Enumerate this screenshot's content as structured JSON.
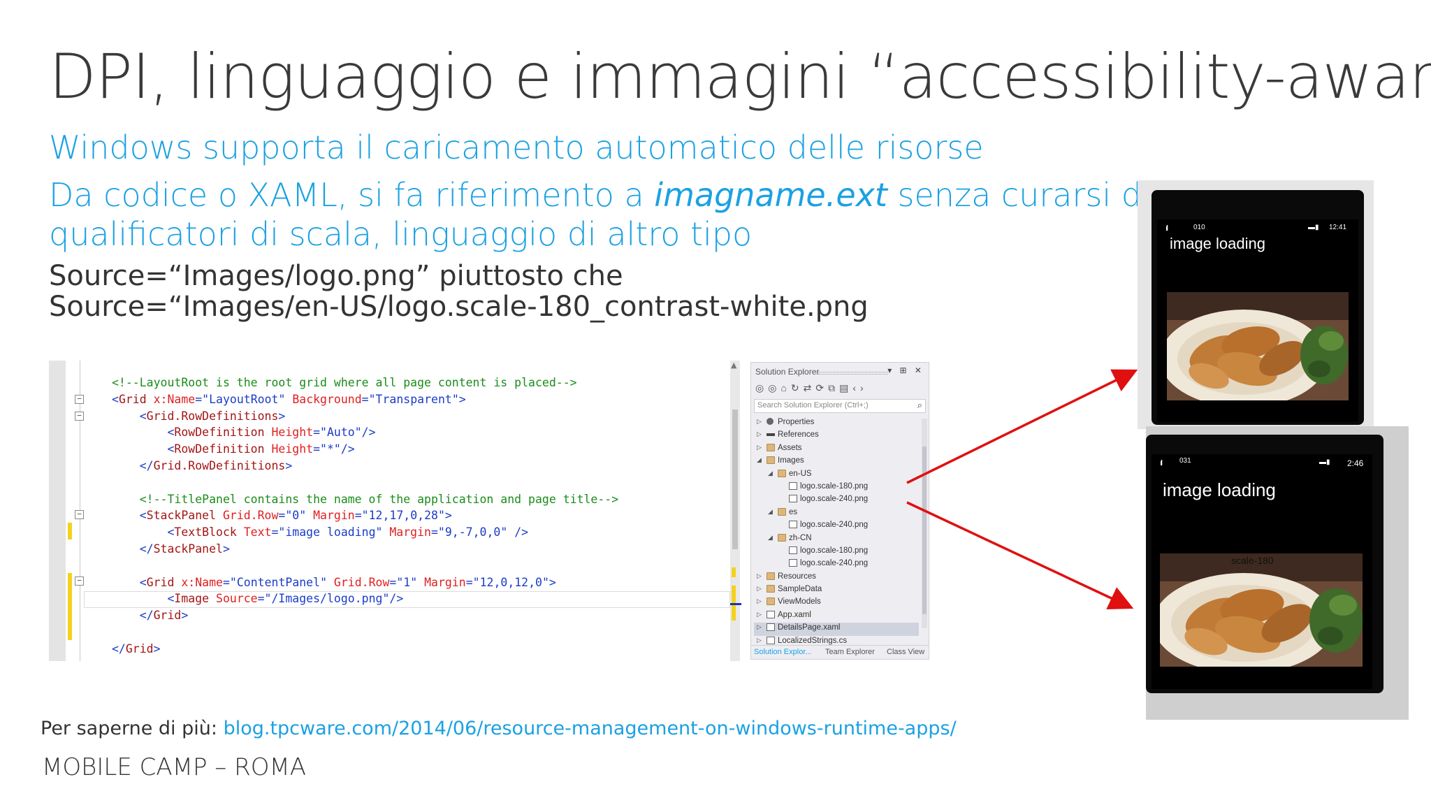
{
  "slide": {
    "title": "DPI, linguaggio e immagini “accessibility-aware”",
    "bullet1": "Windows supporta il caricamento automatico delle risorse",
    "bullet2_pre": "Da codice o XAML, si fa riferimento a ",
    "bullet2_em": "imagname.ext",
    "bullet2_post": " senza curarsi dei",
    "bullet2_line2": "qualificatori di scala, linguaggio di altro tipo",
    "example1": "Source=“Images/logo.png” piuttosto che",
    "example2": "Source=“Images/en-US/logo.scale-180_contrast-white.png"
  },
  "code": {
    "lines": [
      [
        {
          "t": "<!--LayoutRoot is the root grid where all page content is placed-->",
          "c": "comment"
        }
      ],
      [
        {
          "t": "<",
          "c": "punct"
        },
        {
          "t": "Grid",
          "c": "tag"
        },
        {
          "t": " x:Name",
          "c": "attr"
        },
        {
          "t": "=\"",
          "c": "punct"
        },
        {
          "t": "LayoutRoot",
          "c": "val"
        },
        {
          "t": "\"",
          "c": "punct"
        },
        {
          "t": " Background",
          "c": "attr"
        },
        {
          "t": "=\"",
          "c": "punct"
        },
        {
          "t": "Transparent",
          "c": "val"
        },
        {
          "t": "\">",
          "c": "punct"
        }
      ],
      [
        {
          "t": "    <",
          "c": "punct"
        },
        {
          "t": "Grid.RowDefinitions",
          "c": "tag"
        },
        {
          "t": ">",
          "c": "punct"
        }
      ],
      [
        {
          "t": "        <",
          "c": "punct"
        },
        {
          "t": "RowDefinition",
          "c": "tag"
        },
        {
          "t": " Height",
          "c": "attr"
        },
        {
          "t": "=\"",
          "c": "punct"
        },
        {
          "t": "Auto",
          "c": "val"
        },
        {
          "t": "\"/>",
          "c": "punct"
        }
      ],
      [
        {
          "t": "        <",
          "c": "punct"
        },
        {
          "t": "RowDefinition",
          "c": "tag"
        },
        {
          "t": " Height",
          "c": "attr"
        },
        {
          "t": "=\"",
          "c": "punct"
        },
        {
          "t": "*",
          "c": "val"
        },
        {
          "t": "\"/>",
          "c": "punct"
        }
      ],
      [
        {
          "t": "    </",
          "c": "punct"
        },
        {
          "t": "Grid.RowDefinitions",
          "c": "tag"
        },
        {
          "t": ">",
          "c": "punct"
        }
      ],
      [
        {
          "t": "",
          "c": "punct"
        }
      ],
      [
        {
          "t": "    <!--TitlePanel contains the name of the application and page title-->",
          "c": "comment"
        }
      ],
      [
        {
          "t": "    <",
          "c": "punct"
        },
        {
          "t": "StackPanel",
          "c": "tag"
        },
        {
          "t": " Grid.Row",
          "c": "attr"
        },
        {
          "t": "=\"",
          "c": "punct"
        },
        {
          "t": "0",
          "c": "val"
        },
        {
          "t": "\"",
          "c": "punct"
        },
        {
          "t": " Margin",
          "c": "attr"
        },
        {
          "t": "=\"",
          "c": "punct"
        },
        {
          "t": "12,17,0,28",
          "c": "val"
        },
        {
          "t": "\">",
          "c": "punct"
        }
      ],
      [
        {
          "t": "        <",
          "c": "punct"
        },
        {
          "t": "TextBlock",
          "c": "tag"
        },
        {
          "t": " Text",
          "c": "attr"
        },
        {
          "t": "=\"",
          "c": "punct"
        },
        {
          "t": "image loading",
          "c": "val"
        },
        {
          "t": "\"",
          "c": "punct"
        },
        {
          "t": " Margin",
          "c": "attr"
        },
        {
          "t": "=\"",
          "c": "punct"
        },
        {
          "t": "9,-7,0,0",
          "c": "val"
        },
        {
          "t": "\" />",
          "c": "punct"
        }
      ],
      [
        {
          "t": "    </",
          "c": "punct"
        },
        {
          "t": "StackPanel",
          "c": "tag"
        },
        {
          "t": ">",
          "c": "punct"
        }
      ],
      [
        {
          "t": "",
          "c": "punct"
        }
      ],
      [
        {
          "t": "    <",
          "c": "punct"
        },
        {
          "t": "Grid",
          "c": "tag"
        },
        {
          "t": " x:Name",
          "c": "attr"
        },
        {
          "t": "=\"",
          "c": "punct"
        },
        {
          "t": "ContentPanel",
          "c": "val"
        },
        {
          "t": "\"",
          "c": "punct"
        },
        {
          "t": " Grid.Row",
          "c": "attr"
        },
        {
          "t": "=\"",
          "c": "punct"
        },
        {
          "t": "1",
          "c": "val"
        },
        {
          "t": "\"",
          "c": "punct"
        },
        {
          "t": " Margin",
          "c": "attr"
        },
        {
          "t": "=\"",
          "c": "punct"
        },
        {
          "t": "12,0,12,0",
          "c": "val"
        },
        {
          "t": "\">",
          "c": "punct"
        }
      ],
      [
        {
          "t": "        <",
          "c": "punct"
        },
        {
          "t": "Image",
          "c": "tag"
        },
        {
          "t": " Source",
          "c": "attr"
        },
        {
          "t": "=\"",
          "c": "punct"
        },
        {
          "t": "/Images/logo.png",
          "c": "val"
        },
        {
          "t": "\"/>",
          "c": "punct"
        }
      ],
      [
        {
          "t": "    </",
          "c": "punct"
        },
        {
          "t": "Grid",
          "c": "tag"
        },
        {
          "t": ">",
          "c": "punct"
        }
      ],
      [
        {
          "t": "",
          "c": "punct"
        }
      ],
      [
        {
          "t": "</",
          "c": "punct"
        },
        {
          "t": "Grid",
          "c": "tag"
        },
        {
          "t": ">",
          "c": "punct"
        }
      ]
    ],
    "colors": {
      "comment": "#1a8c1a",
      "tag": "#a31515",
      "attr": "#e02020",
      "val": "#1a3cc8",
      "punct": "#1a3cc8"
    }
  },
  "solution_explorer": {
    "title": "Solution Explorer",
    "header_buttons": "▾ ⊞ ✕",
    "search_placeholder": "Search Solution Explorer (Ctrl+;)",
    "tree": [
      {
        "label": "Properties",
        "level": 1,
        "icon": "gear-icon",
        "arrow": "collapsed"
      },
      {
        "label": "References",
        "level": 1,
        "icon": "references-icon",
        "arrow": "collapsed"
      },
      {
        "label": "Assets",
        "level": 1,
        "icon": "folder-icon",
        "arrow": "collapsed"
      },
      {
        "label": "Images",
        "level": 1,
        "icon": "folder-icon",
        "arrow": "expanded"
      },
      {
        "label": "en-US",
        "level": 2,
        "icon": "folder-icon",
        "arrow": "expanded"
      },
      {
        "label": "logo.scale-180.png",
        "level": 3,
        "icon": "image-file-icon",
        "arrow": "none"
      },
      {
        "label": "logo.scale-240.png",
        "level": 3,
        "icon": "image-file-icon",
        "arrow": "none"
      },
      {
        "label": "es",
        "level": 2,
        "icon": "folder-icon",
        "arrow": "expanded"
      },
      {
        "label": "logo.scale-240.png",
        "level": 3,
        "icon": "image-file-icon",
        "arrow": "none"
      },
      {
        "label": "zh-CN",
        "level": 2,
        "icon": "folder-icon",
        "arrow": "expanded"
      },
      {
        "label": "logo.scale-180.png",
        "level": 3,
        "icon": "image-file-icon",
        "arrow": "none"
      },
      {
        "label": "logo.scale-240.png",
        "level": 3,
        "icon": "image-file-icon",
        "arrow": "none"
      },
      {
        "label": "Resources",
        "level": 1,
        "icon": "folder-icon",
        "arrow": "collapsed"
      },
      {
        "label": "SampleData",
        "level": 1,
        "icon": "folder-icon",
        "arrow": "collapsed"
      },
      {
        "label": "ViewModels",
        "level": 1,
        "icon": "folder-icon",
        "arrow": "collapsed"
      },
      {
        "label": "App.xaml",
        "level": 1,
        "icon": "file-icon",
        "arrow": "collapsed"
      },
      {
        "label": "DetailsPage.xaml",
        "level": 1,
        "icon": "file-icon",
        "arrow": "collapsed",
        "selected": true
      },
      {
        "label": "LocalizedStrings.cs",
        "level": 1,
        "icon": "file-icon",
        "arrow": "collapsed"
      }
    ],
    "tabs": [
      "Solution Explor...",
      "Team Explorer",
      "Class View"
    ]
  },
  "phone1": {
    "signal": "ıll",
    "status_num": "010",
    "clock": "12:41",
    "title": "image loading"
  },
  "phone2": {
    "signal": "ıll",
    "status_num": "031",
    "clock": "2:46",
    "title": "image loading",
    "scale_label": "scale-180"
  },
  "footer": {
    "more_label": "Per saperne di più: ",
    "more_link": "blog.tpcware.com/2014/06/resource-management-on-windows-runtime-apps/",
    "event": "MOBILE CAMP – ROMA"
  },
  "colors": {
    "accent": "#1ba1e2",
    "arrow": "#e01010"
  }
}
